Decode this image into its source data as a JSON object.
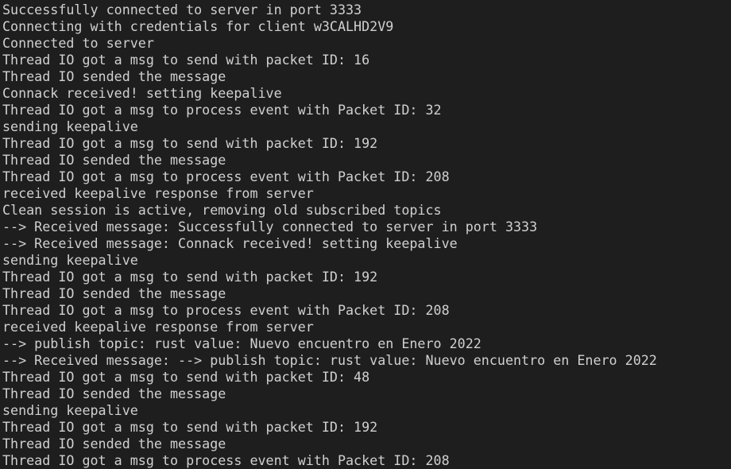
{
  "terminal": {
    "lines": [
      "Successfully connected to server in port 3333",
      "Connecting with credentials for client w3CALHD2V9",
      "Connected to server",
      "Thread IO got a msg to send with packet ID: 16",
      "Thread IO sended the message",
      "Connack received! setting keepalive",
      "Thread IO got a msg to process event with Packet ID: 32",
      "sending keepalive",
      "Thread IO got a msg to send with packet ID: 192",
      "Thread IO sended the message",
      "Thread IO got a msg to process event with Packet ID: 208",
      "received keepalive response from server",
      "Clean session is active, removing old subscribed topics",
      "--> Received message: Successfully connected to server in port 3333",
      "--> Received message: Connack received! setting keepalive",
      "sending keepalive",
      "Thread IO got a msg to send with packet ID: 192",
      "Thread IO sended the message",
      "Thread IO got a msg to process event with Packet ID: 208",
      "received keepalive response from server",
      "--> publish topic: rust value: Nuevo encuentro en Enero 2022",
      "--> Received message: --> publish topic: rust value: Nuevo encuentro en Enero 2022",
      "Thread IO got a msg to send with packet ID: 48",
      "Thread IO sended the message",
      "sending keepalive",
      "Thread IO got a msg to send with packet ID: 192",
      "Thread IO sended the message",
      "Thread IO got a msg to process event with Packet ID: 208"
    ]
  }
}
